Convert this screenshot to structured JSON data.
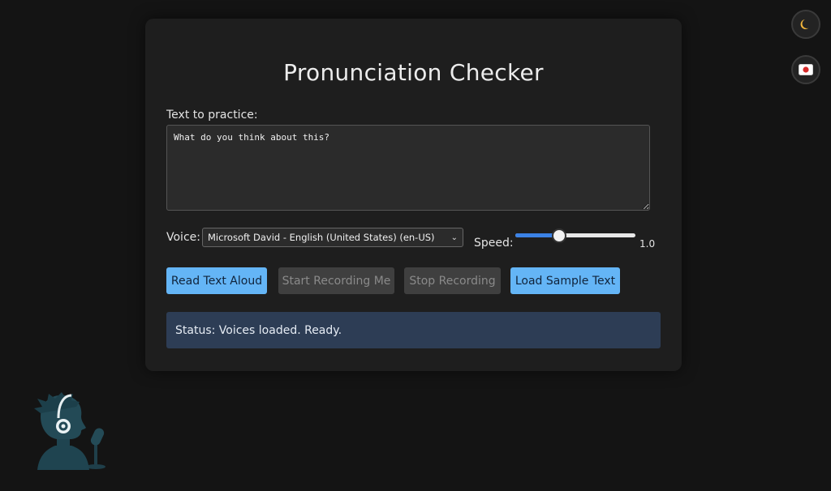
{
  "title": "Pronunciation Checker",
  "text_label": "Text to practice:",
  "text_value": "What do you think about this?",
  "voice_label": "Voice:",
  "voice_selected": "Microsoft David - English (United States) (en-US)",
  "speed_label": "Speed:",
  "speed_value": "1.0",
  "speed_fraction": 0.36,
  "buttons": {
    "read": "Read Text Aloud",
    "start": "Start Recording Me",
    "stop": "Stop Recording",
    "load": "Load Sample Text"
  },
  "status": "Status: Voices loaded. Ready.",
  "icons": {
    "theme": "moon-icon",
    "language": "japan-flag-icon",
    "mascot": "headphones-microphone-silhouette"
  },
  "colors": {
    "accent": "#64b5f6",
    "slider_fill": "#3b82e6",
    "status_bg": "#2d3d55",
    "background": "#141414",
    "card": "#1e1e1e"
  }
}
